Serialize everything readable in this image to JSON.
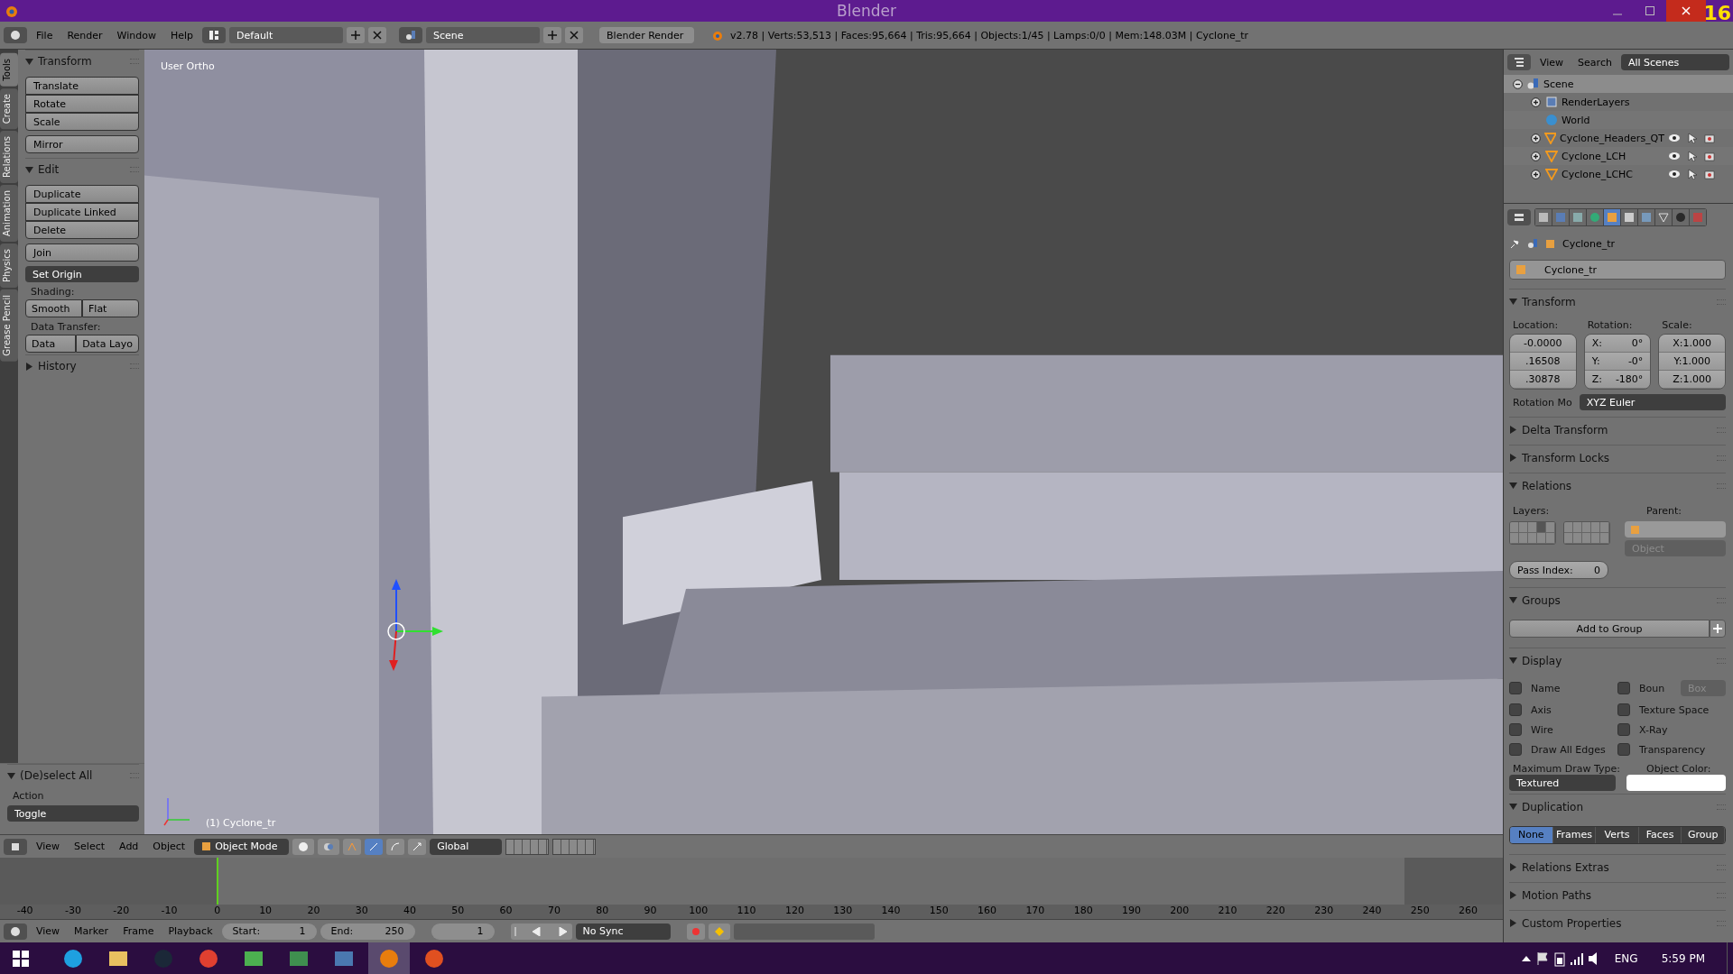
{
  "title_bar": {
    "title": "Blender",
    "badge": "16"
  },
  "info_header": {
    "menus": [
      "File",
      "Render",
      "Window",
      "Help"
    ],
    "layout": "Default",
    "scene": "Scene",
    "engine": "Blender Render",
    "stats": "v2.78 | Verts:53,513 | Faces:95,664 | Tris:95,664 | Objects:1/45 | Lamps:0/0 | Mem:148.03M | Cyclone_tr"
  },
  "tool_shelf": {
    "tabs": [
      {
        "label": "Tools",
        "selected": true
      },
      {
        "label": "Create",
        "selected": false
      },
      {
        "label": "Relations",
        "selected": false
      },
      {
        "label": "Animation",
        "selected": false
      },
      {
        "label": "Physics",
        "selected": false
      },
      {
        "label": "Grease Pencil",
        "selected": false
      }
    ],
    "panels": [
      {
        "title": "Transform",
        "expanded": true,
        "rows": [
          {
            "kind": "stack",
            "buttons": [
              "Translate",
              "Rotate",
              "Scale"
            ]
          },
          {
            "kind": "stack",
            "buttons": [
              "Mirror"
            ]
          }
        ]
      },
      {
        "title": "Edit",
        "expanded": true,
        "rows": [
          {
            "kind": "stack",
            "buttons": [
              "Duplicate",
              "Duplicate Linked",
              "Delete"
            ]
          },
          {
            "kind": "stack",
            "buttons": [
              "Join"
            ]
          },
          {
            "kind": "dropdown",
            "value": "Set Origin"
          },
          {
            "kind": "label",
            "text": "Shading:"
          },
          {
            "kind": "pair",
            "buttons": [
              "Smooth",
              "Flat"
            ]
          },
          {
            "kind": "label",
            "text": "Data Transfer:"
          },
          {
            "kind": "pair",
            "buttons": [
              "Data",
              "Data Layo"
            ]
          }
        ]
      },
      {
        "title": "History",
        "expanded": false
      }
    ]
  },
  "operator_panel": {
    "title": "(De)select All",
    "expanded": true,
    "label": "Action",
    "value": "Toggle"
  },
  "viewport": {
    "view_name": "User Ortho",
    "object_name": "(1) Cyclone_tr"
  },
  "outliner": {
    "menus": [
      "View",
      "Search"
    ],
    "filter": "All Scenes",
    "tree": [
      {
        "name": "Scene",
        "kind": "scene",
        "selected": true,
        "expanded": true,
        "children": [
          {
            "name": "RenderLayers",
            "kind": "renderlayers",
            "selected": false,
            "expanded": false
          },
          {
            "name": "World",
            "kind": "world",
            "selected": false
          },
          {
            "name": "Cyclone_Headers_QT",
            "kind": "mesh",
            "selected": false,
            "expanded": false
          },
          {
            "name": "Cyclone_LCH",
            "kind": "mesh",
            "selected": false,
            "expanded": false
          },
          {
            "name": "Cyclone_LCHC",
            "kind": "mesh",
            "selected": false,
            "expanded": false
          }
        ]
      }
    ]
  },
  "properties": {
    "tabs": [
      {
        "kind": "render",
        "selected": false
      },
      {
        "kind": "layers",
        "selected": false
      },
      {
        "kind": "scene",
        "selected": false
      },
      {
        "kind": "world",
        "selected": false
      },
      {
        "kind": "object",
        "selected": true
      },
      {
        "kind": "constraints",
        "selected": false
      },
      {
        "kind": "modifiers",
        "selected": false
      },
      {
        "kind": "data",
        "selected": false
      },
      {
        "kind": "material",
        "selected": false
      },
      {
        "kind": "texture",
        "selected": false
      }
    ],
    "breadcrumb": "Cyclone_tr",
    "name": "Cyclone_tr",
    "sections": [
      {
        "kind": "transform",
        "title": "Transform",
        "expanded": true,
        "location_label": "Location:",
        "rotation_label": "Rotation:",
        "scale_label": "Scale:",
        "location": [
          "-0.0000",
          ".16508",
          ".30878"
        ],
        "rotation": [
          {
            "axis": "X:",
            "value": "0°"
          },
          {
            "axis": "Y:",
            "value": "-0°"
          },
          {
            "axis": "Z:",
            "value": "-180°"
          }
        ],
        "scale": [
          {
            "axis": "X:",
            "value": "1.000"
          },
          {
            "axis": "Y:",
            "value": "1.000"
          },
          {
            "axis": "Z:",
            "value": "1.000"
          }
        ],
        "mode_label": "Rotation Mo",
        "mode": "XYZ Euler"
      },
      {
        "title": "Delta Transform",
        "expanded": false
      },
      {
        "title": "Transform Locks",
        "expanded": false
      },
      {
        "kind": "relations",
        "title": "Relations",
        "expanded": true,
        "layers_label": "Layers:",
        "parent_label": "Parent:",
        "layers": [
          false,
          false,
          false,
          true,
          false,
          false,
          false,
          false,
          false,
          false,
          false,
          false,
          false,
          false,
          false,
          false,
          false,
          false,
          false,
          false
        ],
        "parent_type": "Object",
        "pass_label": "Pass Index:",
        "pass_value": "0"
      },
      {
        "kind": "groups",
        "title": "Groups",
        "expanded": true,
        "button": "Add to Group"
      },
      {
        "kind": "display",
        "title": "Display",
        "expanded": true,
        "checks": [
          {
            "label": "Name",
            "checked": false
          },
          {
            "label": "Boun",
            "checked": false,
            "dropdown": "Box"
          },
          {
            "label": "Axis",
            "checked": false
          },
          {
            "label": "Texture Space",
            "checked": false
          },
          {
            "label": "Wire",
            "checked": false
          },
          {
            "label": "X-Ray",
            "checked": false
          },
          {
            "label": "Draw All Edges",
            "checked": false
          },
          {
            "label": "Transparency",
            "checked": false
          }
        ],
        "draw_type_label": "Maximum Draw Type:",
        "draw_type": "Textured",
        "color_label": "Object Color:"
      },
      {
        "kind": "duplication",
        "title": "Duplication",
        "expanded": true,
        "options": [
          {
            "label": "None",
            "selected": true
          },
          {
            "label": "Frames",
            "selected": false
          },
          {
            "label": "Verts",
            "selected": false
          },
          {
            "label": "Faces",
            "selected": false
          },
          {
            "label": "Group",
            "selected": false
          }
        ]
      },
      {
        "title": "Relations Extras",
        "expanded": false
      },
      {
        "title": "Motion Paths",
        "expanded": false
      },
      {
        "title": "Custom Properties",
        "expanded": false
      }
    ]
  },
  "view3d_header": {
    "menus": [
      "View",
      "Select",
      "Add",
      "Object"
    ],
    "mode": "Object Mode",
    "orientation": "Global"
  },
  "timeline": {
    "ticks": [
      "-40",
      "-30",
      "-20",
      "-10",
      "0",
      "10",
      "20",
      "30",
      "40",
      "50",
      "60",
      "70",
      "80",
      "90",
      "100",
      "110",
      "120",
      "130",
      "140",
      "150",
      "160",
      "170",
      "180",
      "190",
      "200",
      "210",
      "220",
      "230",
      "240",
      "250",
      "260"
    ]
  },
  "timeline_header": {
    "menus": [
      "View",
      "Marker",
      "Frame",
      "Playback"
    ],
    "start_label": "Start:",
    "start": "1",
    "end_label": "End:",
    "end": "250",
    "current": "1",
    "sync": "No Sync"
  },
  "taskbar": {
    "apps": [
      {
        "kind": "skype",
        "active": false
      },
      {
        "kind": "folder",
        "active": false
      },
      {
        "kind": "steam",
        "active": false
      },
      {
        "kind": "chrome",
        "active": false
      },
      {
        "kind": "paint",
        "active": false
      },
      {
        "kind": "sheet",
        "active": false
      },
      {
        "kind": "window",
        "active": false
      },
      {
        "kind": "blender",
        "active": true
      },
      {
        "kind": "nodes",
        "active": false
      }
    ],
    "language": "ENG",
    "time": "5:59 PM"
  }
}
